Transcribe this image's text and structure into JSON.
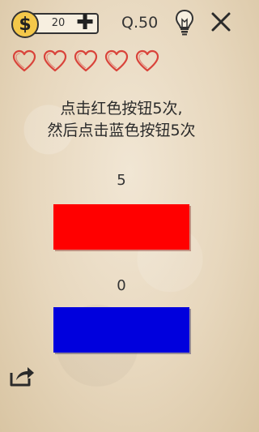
{
  "header": {
    "coin_symbol": "$",
    "coin_count": "20",
    "plus_symbol": "✚",
    "level_label": "Q.50"
  },
  "lives": {
    "count": 5,
    "icon": "heart-outline",
    "color": "#d9433a"
  },
  "instruction": {
    "line1": "点击红色按钮5次,",
    "line2": "然后点击蓝色按钮5次"
  },
  "red_button": {
    "count": "5",
    "color": "#ff0000"
  },
  "blue_button": {
    "count": "0",
    "color": "#0000dd"
  },
  "icons": {
    "hint": "lightbulb-icon",
    "close": "close-icon",
    "share": "share-icon"
  }
}
